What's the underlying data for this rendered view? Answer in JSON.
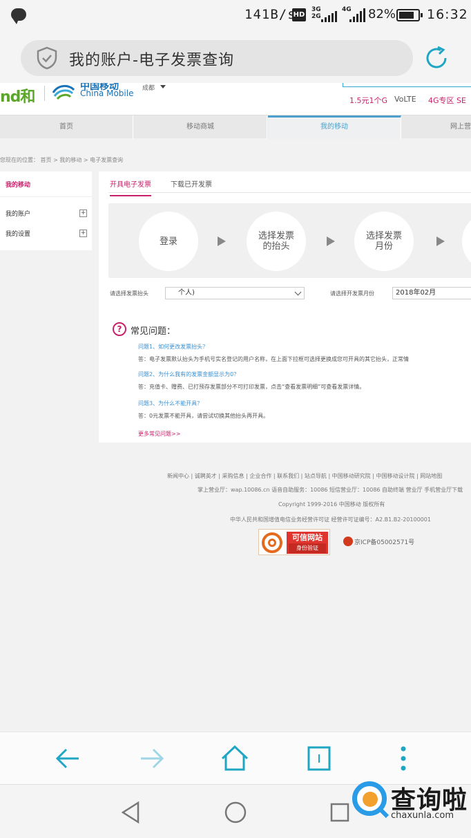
{
  "status_bar": {
    "net_speed": "141B/s",
    "hd": "HD",
    "sim1_types": [
      "3G",
      "2G"
    ],
    "sim2_type": "4G",
    "battery": "82%",
    "battery_level": 0.82,
    "time": "16:32"
  },
  "address_bar": {
    "title": "我的账户-电子发票查询"
  },
  "site_header": {
    "brand_he": "和",
    "brand_cn": "中国移动",
    "brand_en": "China Mobile",
    "city": "成都",
    "promos": [
      "1.5元1个G",
      "VoLTE",
      "4G专区 SE"
    ]
  },
  "nav": {
    "items": [
      "首页",
      "移动商城",
      "我的移动",
      "网上营"
    ],
    "active_index": 2
  },
  "breadcrumb": "您现在的位置： 首页 > 我的移动 > 电子发票查询",
  "sidebar": {
    "title": "我的移动",
    "items": [
      {
        "label": "我的账户",
        "toggle": "+"
      },
      {
        "label": "我的设置",
        "toggle": "+"
      }
    ]
  },
  "main": {
    "tabs": [
      "开具电子发票",
      "下载已开发票"
    ],
    "steps": [
      "登录",
      "选择发票\n的抬头",
      "选择发票\n月份"
    ],
    "form": {
      "title_label": "请选择发票抬头",
      "title_value": "个人)",
      "month_label": "请选择开发票月份",
      "month_value": "2018年02月"
    },
    "faq": {
      "icon": "?",
      "title": "常见问题：",
      "items": [
        {
          "q": "问题1、如何更改发票抬头？",
          "a": "答：电子发票默认抬头为手机号实名登记的用户名称，在上面下拉框可选择更换成您可开具的其它抬头，正常情"
        },
        {
          "q": "问题2、为什么我有的发票金额显示为0？",
          "a": "答：充值卡、赠费、已打预存发票部分不可打印发票，点击“查看发票明细”可查看发票详情。"
        },
        {
          "q": "问题3、为什么不能开具？",
          "a": "答：0元发票不能开具，请尝试切换其他抬头再开具。"
        }
      ],
      "more": "更多常见问题>>"
    }
  },
  "footer": {
    "links": "新闻中心 | 诚聘英才 | 采购信息 | 企业合作 | 联系我们 | 站点导航 | 中国移动研究院 | 中国移动设计院 | 网站地图",
    "wap": "掌上营业厅：wap.10086.cn 语音自助服务：10086 短信营业厅：10086 自助终端 营业厅 手机营业厅下载",
    "copyright": "Copyright 1999-2016 中国移动 版权所有",
    "license": "中华人民共和国增值电信业务经营许可证 经营许可证编号：A2.B1.B2-20100001",
    "badge_title": "可信网站",
    "badge_sub": "身份验证",
    "icp": "京ICP备05002571号"
  },
  "watermark": {
    "cn": "查询啦",
    "en": "chaxunla.com"
  },
  "colors": {
    "brand_pink": "#c8216b",
    "nav_blue": "#4da0cc",
    "browser_teal": "#1fa6c4"
  }
}
